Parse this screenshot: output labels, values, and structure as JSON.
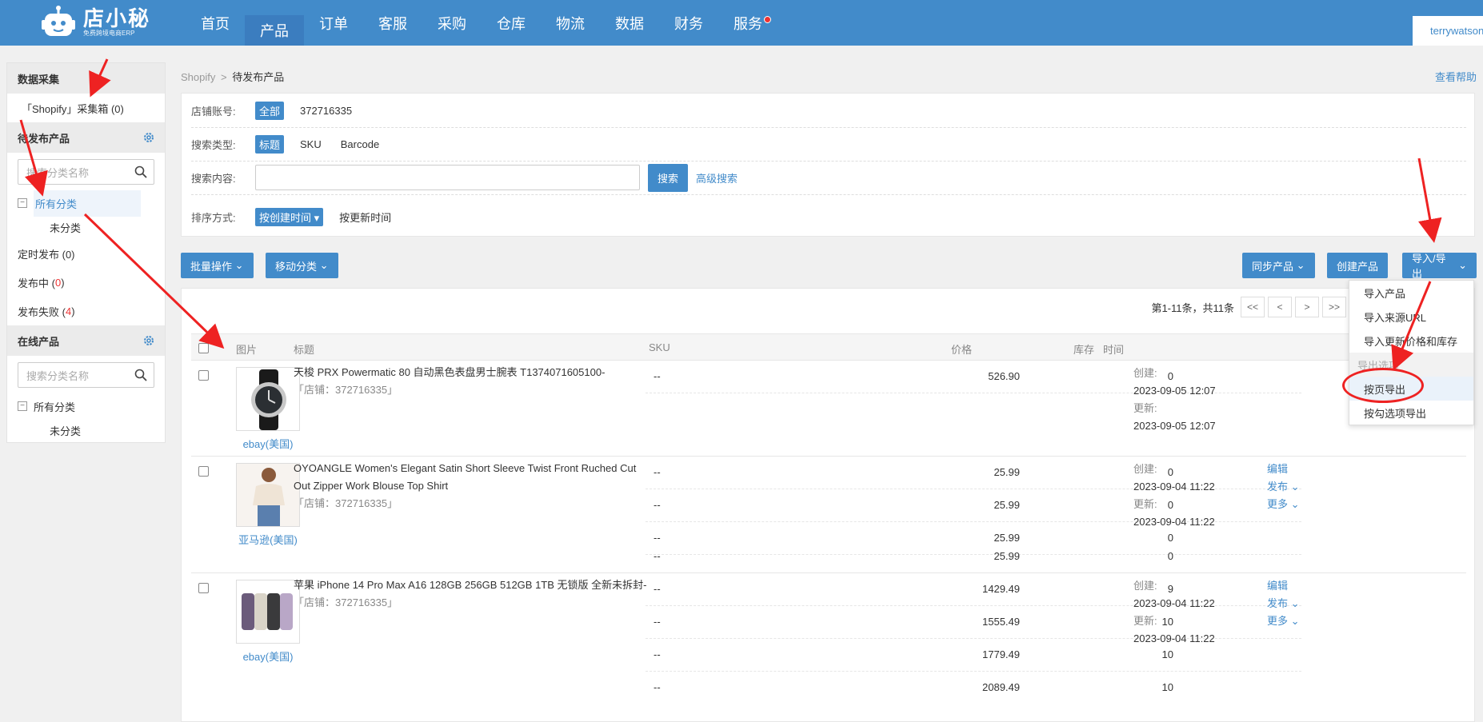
{
  "brand": {
    "name": "店小秘",
    "sub": "免费跨境电商ERP"
  },
  "nav": [
    {
      "label": "首页",
      "active": false
    },
    {
      "label": "产品",
      "active": true
    },
    {
      "label": "订单",
      "active": false
    },
    {
      "label": "客服",
      "active": false
    },
    {
      "label": "采购",
      "active": false
    },
    {
      "label": "仓库",
      "active": false
    },
    {
      "label": "物流",
      "active": false
    },
    {
      "label": "数据",
      "active": false
    },
    {
      "label": "财务",
      "active": false
    },
    {
      "label": "服务",
      "active": false
    }
  ],
  "user": {
    "name": "terrywatson"
  },
  "sidebar": {
    "collect_title": "数据采集",
    "collect_box": "「Shopify」采集箱 (0)",
    "pending_title": "待发布产品",
    "search_placeholder": "搜索分类名称",
    "all_category": "所有分类",
    "uncategorized": "未分类",
    "scheduled": "定时发布 (0)",
    "publishing_label": "发布中 (",
    "publishing_count": "0",
    "failed_label": "发布失败 (",
    "failed_count": "4",
    "close_paren": ")",
    "online_title": "在线产品",
    "online_search_placeholder": "搜索分类名称",
    "online_all": "所有分类",
    "online_uncategorized": "未分类"
  },
  "breadcrumb": {
    "parent": "Shopify",
    "sep": ">",
    "current": "待发布产品"
  },
  "help": "查看帮助",
  "filter": {
    "store_label": "店铺账号:",
    "store_all": "全部",
    "store_id": "372716335",
    "type_label": "搜索类型:",
    "type_active": "标题",
    "type_sku": "SKU",
    "type_barcode": "Barcode",
    "content_label": "搜索内容:",
    "search_btn": "搜索",
    "advanced": "高级搜索",
    "sort_label": "排序方式:",
    "sort_active": "按创建时间",
    "sort_update": "按更新时间"
  },
  "toolbar": {
    "batch": "批量操作",
    "move": "移动分类",
    "sync": "同步产品",
    "create": "创建产品",
    "import_export": "导入/导出"
  },
  "pager": {
    "info": "第1-11条，共11条",
    "first": "<<",
    "prev": "<",
    "next": ">",
    "last": ">>"
  },
  "table": {
    "headers": [
      "图片",
      "标题",
      "SKU",
      "价格",
      "库存",
      "时间"
    ]
  },
  "products": [
    {
      "title": "天梭 PRX Powermatic 80 自动黑色表盘男士腕表 T1374071605100-",
      "store": "「店铺：372716335」",
      "source": "ebay(美国)",
      "variants": [
        {
          "sku": "--",
          "price": "526.90",
          "stock": "0"
        }
      ],
      "created_label": "创建:",
      "created": "2023-09-05 12:07",
      "updated_label": "更新:",
      "updated": "2023-09-05 12:07"
    },
    {
      "title": "OYOANGLE Women's Elegant Satin Short Sleeve Twist Front Ruched Cut Out Zipper Work Blouse Top Shirt",
      "store": "「店铺：372716335」",
      "source": "亚马逊(美国)",
      "variants": [
        {
          "sku": "--",
          "price": "25.99",
          "stock": "0"
        },
        {
          "sku": "--",
          "price": "25.99",
          "stock": "0"
        },
        {
          "sku": "--",
          "price": "25.99",
          "stock": "0"
        },
        {
          "sku": "--",
          "price": "25.99",
          "stock": "0"
        }
      ],
      "created_label": "创建:",
      "created": "2023-09-04 11:22",
      "updated_label": "更新:",
      "updated": "2023-09-04 11:22",
      "actions": {
        "edit": "编辑",
        "publish": "发布 ⌄",
        "more": "更多 ⌄"
      }
    },
    {
      "title": "苹果 iPhone 14 Pro Max A16 128GB 256GB 512GB 1TB 无锁版 全新未拆封-",
      "store": "「店铺：372716335」",
      "source": "ebay(美国)",
      "variants": [
        {
          "sku": "--",
          "price": "1429.49",
          "stock": "9"
        },
        {
          "sku": "--",
          "price": "1555.49",
          "stock": "10"
        },
        {
          "sku": "--",
          "price": "1779.49",
          "stock": "10"
        },
        {
          "sku": "--",
          "price": "2089.49",
          "stock": "10"
        }
      ],
      "created_label": "创建:",
      "created": "2023-09-04 11:22",
      "updated_label": "更新:",
      "updated": "2023-09-04 11:22",
      "actions": {
        "edit": "编辑",
        "publish": "发布 ⌄",
        "more": "更多 ⌄"
      }
    }
  ],
  "dropdown": {
    "import_product": "导入产品",
    "import_url": "导入来源URL",
    "import_update": "导入更新价格和库存",
    "export_header": "导出选项",
    "export_page": "按页导出",
    "export_checked": "按勾选项导出"
  },
  "colors": {
    "primary": "#428bca",
    "annotation": "#ee2222",
    "count_red": "#e33"
  }
}
